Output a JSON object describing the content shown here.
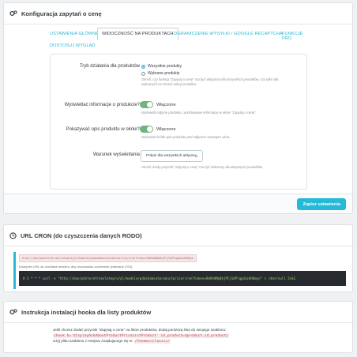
{
  "config_panel": {
    "title": "Konfiguracja zapytań o cenę",
    "tabs": [
      {
        "label": "USTAWIENIA GŁÓWNE"
      },
      {
        "label": "WIDOCZNOŚĆ NA PRODUKTACH"
      },
      {
        "label": "OGRANICZENIE WYSYŁKI / GOOGLE RECAPTCHA"
      },
      {
        "label": "FUNKCJE PRO"
      },
      {
        "label": "DOSTOSUJ WYGLĄD"
      }
    ],
    "active_tab": "WIDOCZNOŚĆ NA PRODUKTACH",
    "mode": {
      "label": "Tryb działania dla produktów",
      "options": [
        "Wszystkie produkty",
        "Wybrane produkty"
      ],
      "selected": "Wszystkie produkty",
      "help": "Określ, czy funkcja \"Zapytaj o cenę\" ma być włączona dla wszystkich produktów, czy tylko dla wybranych na stronie edycji produktu."
    },
    "show_info": {
      "label": "Wyświetlać informacje o produkcie?",
      "state": "Włączone",
      "help": "Wyświetla zdjęcie produktu i podstawowe informacje w oknie \"Zapytaj o cenę\"."
    },
    "show_desc": {
      "label": "Pokazywać opis produktu w oknie?",
      "state": "Włączone",
      "help": "Wyświetla krótki opis produktu pod zdjęciem wewnątrz okna."
    },
    "display_condition": {
      "label": "Warunek wyświetlania",
      "value": "Pokaż dla wszystkich aktywny",
      "help": "Określ, kiedy przycisk \"Zapytaj o cenę\" ma być widoczny dla aktywnych produktów."
    },
    "save_label": "Zapisz ustawienia"
  },
  "cron_panel": {
    "title": "URL CRON (do czyszczenia danych RODO)",
    "url": "http://box/pdstoretranslatepro/pl/module/pdaskaboutproductprice/cron?token=RmRsWMpQkjPCjSdPlqg3azdHUmye",
    "note": "Dodaj ten URL do crontaba serwera, aby uruchamiać codziennie (zalecane 2:00).",
    "command": "0 3 * * * curl -s \"http://box/pdstoretranslatepro/pl/module/pdaskaboutproductprice/cron?token=RmRsWMpQkjPCjSdPlqg3azdHUmye\" > /dev/null 2>&1"
  },
  "hook_panel": {
    "title": "Instrukcja instalacji hooka dla listy produktów",
    "line1": "Jeśli chcesz dodać przycisk \"Zapytaj o cenę\" na liście produktów, dodaj poniższą linię do swojego szablonu:",
    "code": "{hook h='displayAskAboutProductPriceListProduct' id_product=$product.id_product}",
    "line3_prefix": "Użyj pliku szablonu z motywu znajdującego się w:",
    "path": "/themes/classic/"
  },
  "colors": {
    "accent": "#25b9d7",
    "switch_on": "#70b580",
    "terminal_bg": "#272b2f"
  }
}
